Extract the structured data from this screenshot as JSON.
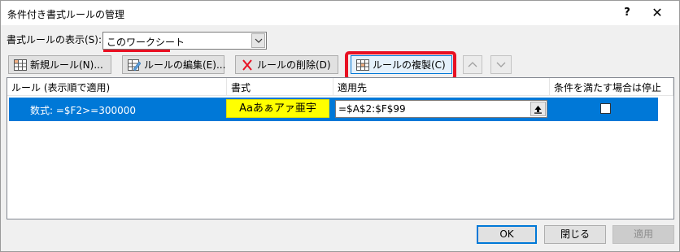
{
  "window": {
    "title": "条件付き書式ルールの管理",
    "help_label": "?",
    "close_label": "✕"
  },
  "scope": {
    "label": "書式ルールの表示(S):",
    "value": "このワークシート"
  },
  "toolbar": {
    "new_rule": "新規ルール(N)...",
    "edit_rule": "ルールの編集(E)...",
    "delete_rule": "ルールの削除(D)",
    "copy_rule": "ルールの複製(C)"
  },
  "grid": {
    "headers": {
      "rule": "ルール (表示順で適用)",
      "format": "書式",
      "applies_to": "適用先",
      "stop_if_true": "条件を満たす場合は停止"
    },
    "rows": [
      {
        "rule": "数式: =$F2>=300000",
        "format_preview": "Aaあぁアァ亜宇",
        "applies_to": "=$A$2:$F$99",
        "stop_if_true": false
      }
    ]
  },
  "buttons": {
    "ok": "OK",
    "close": "閉じる",
    "apply": "適用"
  },
  "colors": {
    "selection": "#0078d7",
    "highlight": "#e81123",
    "format_fill": "#ffff00"
  }
}
